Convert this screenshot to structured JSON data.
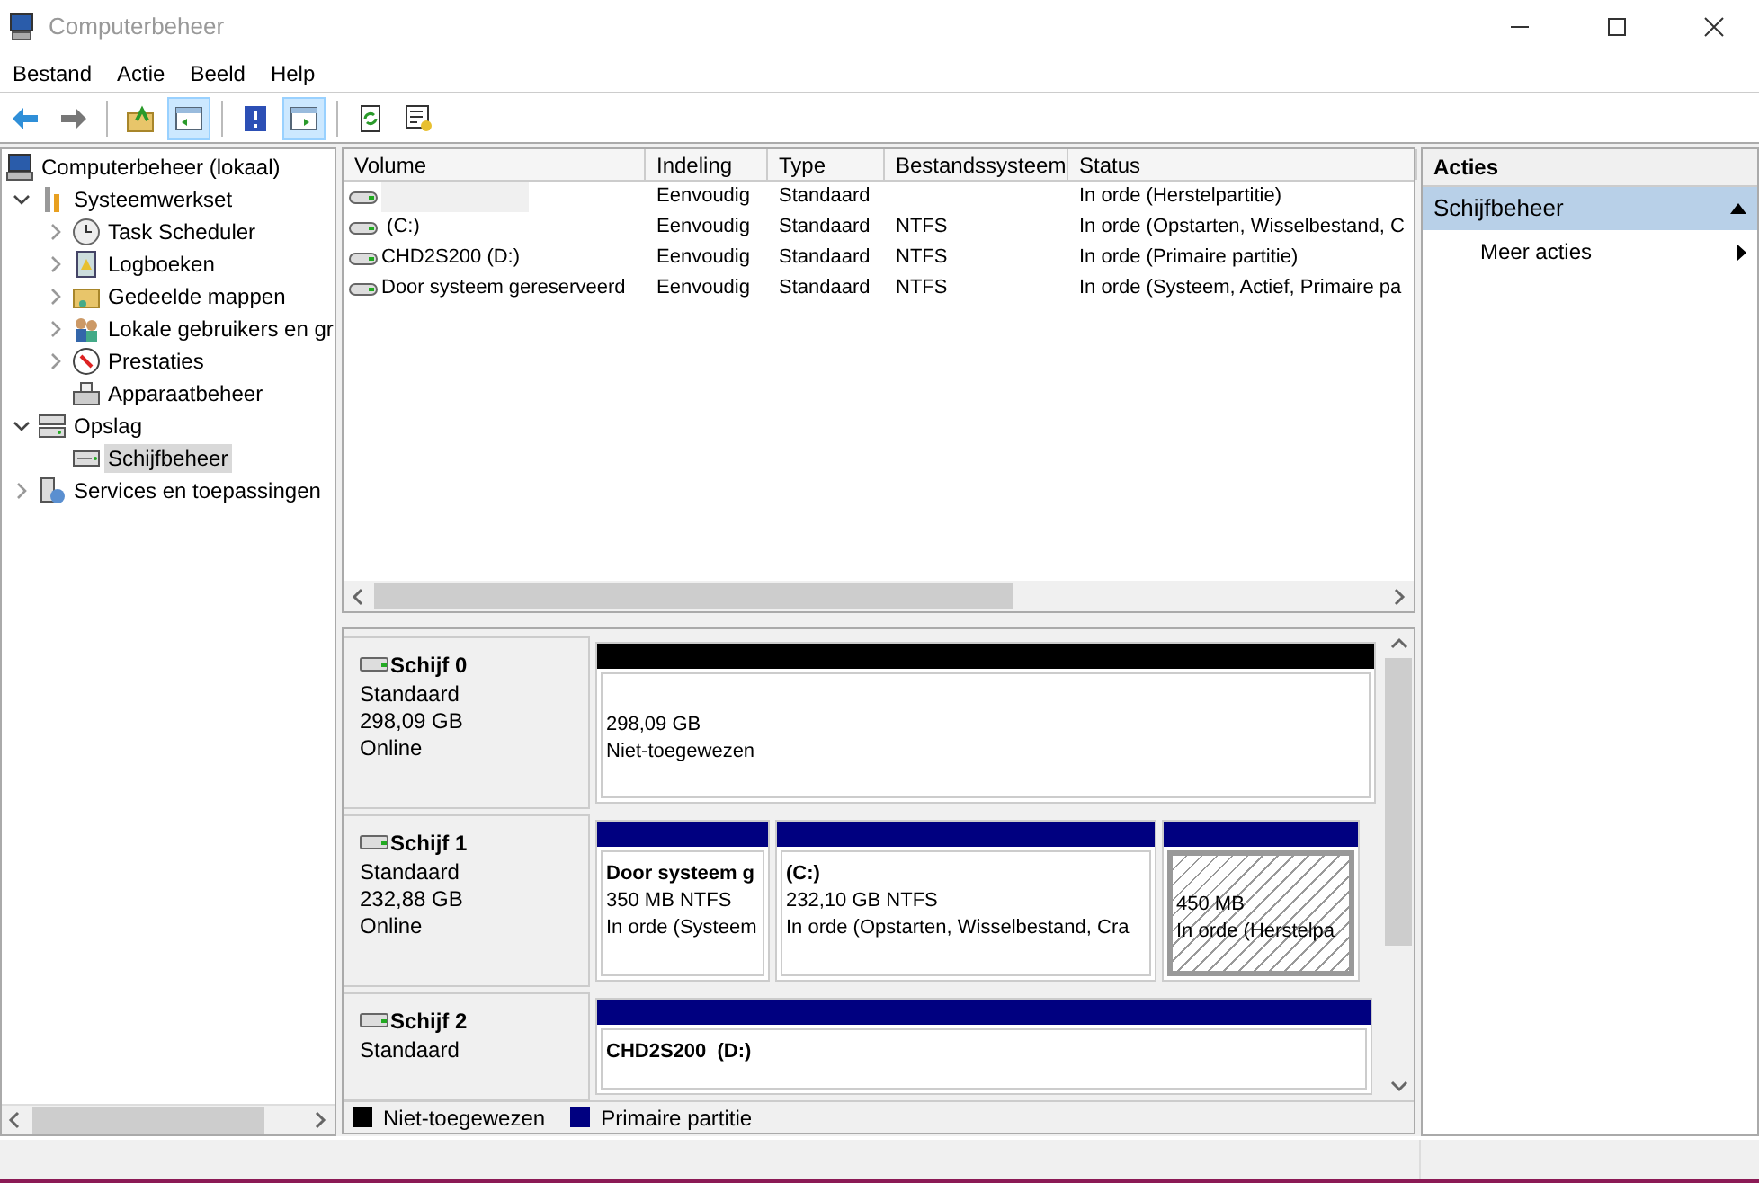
{
  "window": {
    "title": "Computerbeheer"
  },
  "menu": [
    "Bestand",
    "Actie",
    "Beeld",
    "Help"
  ],
  "toolbar": [
    {
      "kind": "back",
      "pressed": false
    },
    {
      "kind": "forward",
      "pressed": false
    },
    {
      "kind": "sep"
    },
    {
      "kind": "up",
      "pressed": false
    },
    {
      "kind": "tree-toggle",
      "pressed": true
    },
    {
      "kind": "sep"
    },
    {
      "kind": "help",
      "pressed": false
    },
    {
      "kind": "action-toggle",
      "pressed": true
    },
    {
      "kind": "sep"
    },
    {
      "kind": "refresh",
      "pressed": false
    },
    {
      "kind": "properties",
      "pressed": false
    }
  ],
  "tree": [
    {
      "label": "Computerbeheer (lokaal)",
      "selected": false,
      "children": [
        {
          "label": "Systeemwerkset",
          "expanded": true,
          "selected": false,
          "children": [
            {
              "label": "Task Scheduler",
              "expanded": false,
              "selected": false
            },
            {
              "label": "Logboeken",
              "expanded": false,
              "selected": false
            },
            {
              "label": "Gedeelde mappen",
              "expanded": false,
              "selected": false
            },
            {
              "label": "Lokale gebruikers en gr",
              "expanded": false,
              "selected": false
            },
            {
              "label": "Prestaties",
              "expanded": false,
              "selected": false
            },
            {
              "label": "Apparaatbeheer",
              "selected": false
            }
          ]
        },
        {
          "label": "Opslag",
          "expanded": true,
          "selected": false,
          "children": [
            {
              "label": "Schijfbeheer",
              "selected": true
            }
          ]
        },
        {
          "label": "Services en toepassingen",
          "expanded": false,
          "selected": false
        }
      ]
    }
  ],
  "volumes": {
    "columns": [
      "Volume",
      "Indeling",
      "Type",
      "Bestandssysteem",
      "Status"
    ],
    "rows": [
      {
        "layout": "Eenvoudig",
        "type": "Standaard",
        "status": "In orde (Herstelpartitie)"
      },
      {
        "volume": " (C:)",
        "layout": "Eenvoudig",
        "type": "Standaard",
        "filesystem": "NTFS",
        "status": "In orde (Opstarten, Wisselbestand, C"
      },
      {
        "volume": "CHD2S200 (D:)",
        "layout": "Eenvoudig",
        "type": "Standaard",
        "filesystem": "NTFS",
        "status": "In orde (Primaire partitie)"
      },
      {
        "volume": "Door systeem gereserveerd",
        "layout": "Eenvoudig",
        "type": "Standaard",
        "filesystem": "NTFS",
        "status": "In orde (Systeem, Actief, Primaire pa"
      }
    ]
  },
  "disks": [
    {
      "name": "Schijf 0",
      "type": "Standaard",
      "size": "298,09 GB",
      "state": "Online",
      "partitions": [
        {
          "kind": "unallocated",
          "selected": false,
          "size": "298,09 GB",
          "status": "Niet-toegewezen"
        }
      ]
    },
    {
      "name": "Schijf 1",
      "type": "Standaard",
      "size": "232,88 GB",
      "state": "Online",
      "partitions": [
        {
          "kind": "primary",
          "selected": false,
          "title": "Door systeem g",
          "size": "350 MB NTFS",
          "status": "In orde (Systeem"
        },
        {
          "kind": "primary",
          "selected": false,
          "title": "(C:)",
          "size": "232,10 GB NTFS",
          "status": "In orde (Opstarten, Wisselbestand, Cra"
        },
        {
          "kind": "primary",
          "selected": true,
          "size": "450 MB",
          "status": "In orde (Herstelpa"
        }
      ]
    },
    {
      "name": "Schijf 2",
      "type": "Standaard",
      "partitions": [
        {
          "kind": "primary",
          "selected": false,
          "title": "CHD2S200  (D:)"
        }
      ]
    }
  ],
  "legend": [
    {
      "label": "Niet-toegewezen",
      "color": "#000000"
    },
    {
      "label": "Primaire partitie",
      "color": "#000080"
    }
  ],
  "actions": {
    "title": "Acties",
    "sections": [
      {
        "label": "Schijfbeheer",
        "expanded": true,
        "items": [
          "Meer acties"
        ]
      }
    ]
  }
}
